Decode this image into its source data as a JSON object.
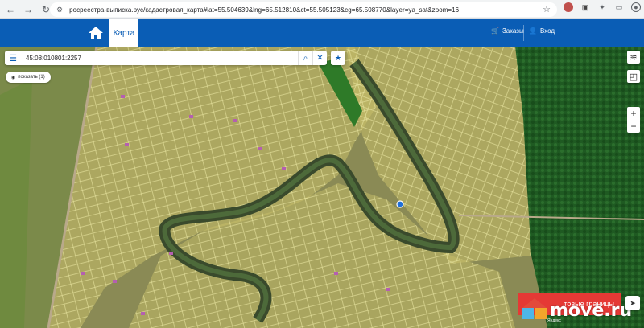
{
  "browser": {
    "url": "росреестра-выписка.рус/кадастровая_карта#lat=55.504639&lng=65.512810&ct=55.505123&cg=65.508770&layer=ya_sat&zoom=16",
    "nav_icons": [
      "back-arrow-icon",
      "forward-arrow-icon",
      "reload-icon"
    ],
    "extension_icons": [
      "star-icon",
      "extension-icon-1",
      "extension-icon-2",
      "puzzle-icon",
      "sidebar-icon",
      "profile-icon",
      "menu-dots-icon"
    ]
  },
  "header": {
    "map_tab_label": "Карта",
    "orders_label": "Заказы",
    "login_label": "Вход",
    "brand_color": "#0a5db5"
  },
  "search": {
    "value": "45:08:010801:2257"
  },
  "show_button_label": "показать (1)",
  "zoom": {
    "in": "+",
    "out": "−"
  },
  "promo_label": "Показать участки",
  "promo_text_visible": "товые границы",
  "watermark_text": "move.ru",
  "map_credit": "Яндекс"
}
